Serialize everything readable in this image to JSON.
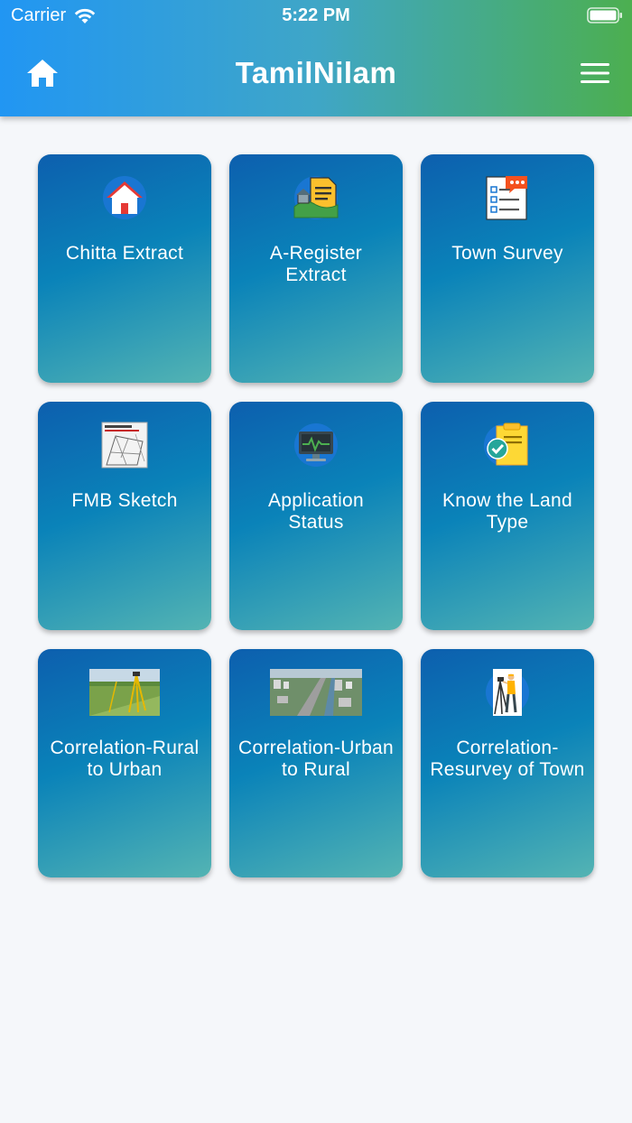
{
  "status_bar": {
    "carrier": "Carrier",
    "time": "5:22 PM"
  },
  "header": {
    "title": "TamilNilam",
    "home_icon": "home-icon",
    "menu_icon": "hamburger-menu-icon"
  },
  "colors": {
    "header_start": "#2196f3",
    "header_end": "#4caf50",
    "tile_top": "#0d5fae",
    "tile_bottom": "#54b4b3"
  },
  "tiles": [
    {
      "label": "Chitta Extract",
      "icon": "house-icon"
    },
    {
      "label": "A-Register Extract",
      "icon": "land-document-icon"
    },
    {
      "label": "Town Survey",
      "icon": "survey-checklist-icon"
    },
    {
      "label": "FMB Sketch",
      "icon": "sketch-map-icon"
    },
    {
      "label": "Application Status",
      "icon": "monitor-status-icon"
    },
    {
      "label": "Know the Land Type",
      "icon": "clipboard-check-icon"
    },
    {
      "label": "Correlation-Rural to Urban",
      "icon": "field-survey-photo-icon"
    },
    {
      "label": "Correlation-Urban to Rural",
      "icon": "city-aerial-photo-icon"
    },
    {
      "label": "Correlation-Resurvey of Town",
      "icon": "surveyor-icon"
    }
  ]
}
